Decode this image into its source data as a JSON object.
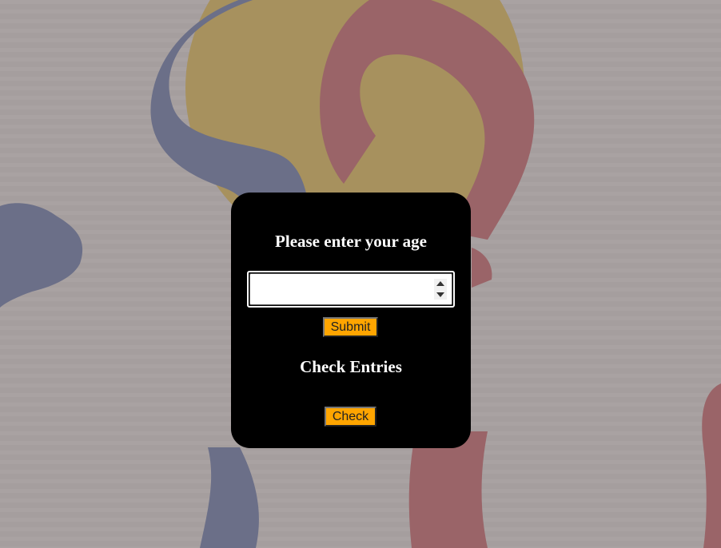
{
  "colors": {
    "overlay": "#a59e9e",
    "modal_bg": "#000000",
    "button_bg": "#ffa500",
    "text": "#ffffff"
  },
  "modal": {
    "title": "Please enter your age",
    "age_input": {
      "value": "",
      "placeholder": ""
    },
    "submit_label": "Submit",
    "entries_title": "Check Entries",
    "check_label": "Check"
  }
}
